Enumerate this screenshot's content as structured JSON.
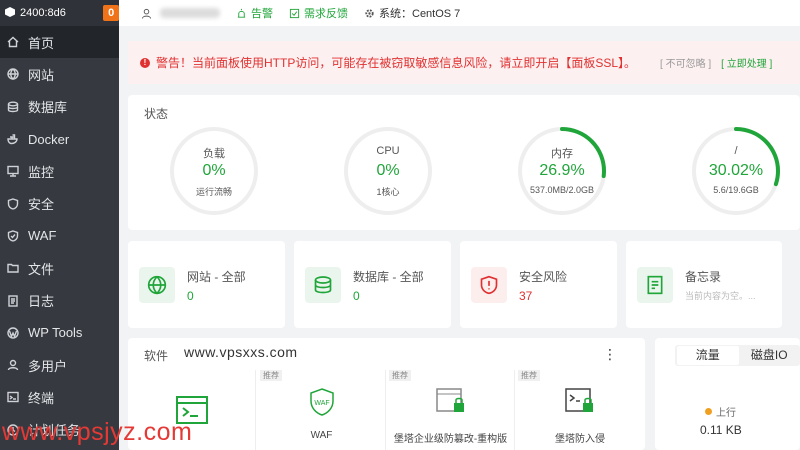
{
  "sidebar": {
    "host": "2400:8d6",
    "badge": "0",
    "items": [
      {
        "label": "首页",
        "icon": "home-icon"
      },
      {
        "label": "网站",
        "icon": "globe-icon"
      },
      {
        "label": "数据库",
        "icon": "database-icon"
      },
      {
        "label": "Docker",
        "icon": "docker-icon"
      },
      {
        "label": "监控",
        "icon": "monitor-icon"
      },
      {
        "label": "安全",
        "icon": "shield-icon"
      },
      {
        "label": "WAF",
        "icon": "waf-shield-icon"
      },
      {
        "label": "文件",
        "icon": "folder-icon"
      },
      {
        "label": "日志",
        "icon": "log-icon"
      },
      {
        "label": "WP Tools",
        "icon": "wordpress-icon"
      },
      {
        "label": "多用户",
        "icon": "users-icon"
      },
      {
        "label": "终端",
        "icon": "terminal-icon"
      },
      {
        "label": "计划任务",
        "icon": "clock-icon"
      }
    ]
  },
  "topbar": {
    "alarm": "告警",
    "feedback": "需求反馈",
    "system": "系统：CentOS 7"
  },
  "alert": {
    "message": "警告！当前面板使用HTTP访问，可能存在被窃取敏感信息风险，请立即开启【面板SSL】。",
    "ignore": "[ 不可忽略 ]",
    "fix": "[ 立即处理 ]"
  },
  "status": {
    "title": "状态",
    "gauges": [
      {
        "label": "负载",
        "value": "0%",
        "sub": "运行流畅",
        "percent": 0
      },
      {
        "label": "CPU",
        "value": "0%",
        "sub": "1核心",
        "percent": 0
      },
      {
        "label": "内存",
        "value": "26.9%",
        "sub": "537.0MB/2.0GB",
        "percent": 26.9
      },
      {
        "label": "/",
        "value": "30.02%",
        "sub": "5.6/19.6GB",
        "percent": 30.02
      }
    ]
  },
  "stats": [
    {
      "label": "网站 - 全部",
      "value": "0",
      "color": "#20a53a",
      "icon": "globe-icon"
    },
    {
      "label": "数据库 - 全部",
      "value": "0",
      "color": "#20a53a",
      "icon": "database-icon"
    },
    {
      "label": "安全风险",
      "value": "37",
      "color": "#e03131",
      "icon": "security-risk-icon"
    },
    {
      "label": "备忘录",
      "value": "当前内容为空。...",
      "color": "#bbb",
      "icon": "memo-icon"
    }
  ],
  "software": {
    "title": "软件",
    "watermark": "www.vpsxxs.com",
    "items": [
      {
        "name": "",
        "tag": "",
        "icon": "terminal-app-icon"
      },
      {
        "name": "WAF",
        "tag": "推荐",
        "icon": "waf-app-icon"
      },
      {
        "name": "堡塔企业级防篡改-重构版",
        "tag": "推荐",
        "icon": "tamper-proof-icon"
      },
      {
        "name": "堡塔防入侵",
        "tag": "推荐",
        "icon": "intrusion-icon"
      }
    ]
  },
  "traffic": {
    "tab1": "流量",
    "tab2": "磁盘IO",
    "up_label": "上行",
    "up_value": "0.11 KB"
  },
  "watermark_bottom": "www.vpsjyz.com",
  "colors": {
    "accent": "#20a53a",
    "danger": "#e03131",
    "sidebar": "#363a40"
  }
}
